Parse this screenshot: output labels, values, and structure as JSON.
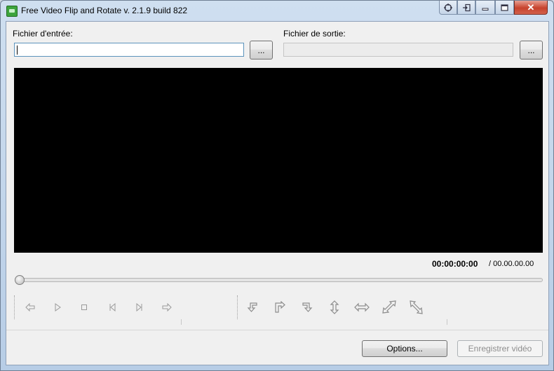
{
  "window": {
    "title": "Free Video Flip and Rotate  v. 2.1.9 build 822",
    "buttons": [
      "restore-icon",
      "pin-icon",
      "minimize-icon",
      "maximize-icon",
      "close-icon"
    ],
    "close_label": "✕"
  },
  "input": {
    "label": "Fichier d'entrée:",
    "value": "",
    "browse_label": "..."
  },
  "output": {
    "label": "Fichier de sortie:",
    "value": "",
    "browse_label": "..."
  },
  "time": {
    "current": "00:00:00:00",
    "total": "/  00.00.00.00"
  },
  "playback": {
    "position_fraction": 0,
    "controls": [
      "prev-frame-icon",
      "play-icon",
      "stop-icon",
      "go-start-icon",
      "go-end-icon",
      "next-frame-icon"
    ]
  },
  "transform": {
    "controls": [
      "rotate-left-icon",
      "rotate-right-icon",
      "rotate-180-icon",
      "flip-vertical-icon",
      "flip-horizontal-icon",
      "transpose-icon",
      "transverse-icon"
    ]
  },
  "actions": {
    "options_label": "Options...",
    "save_label": "Enregistrer vidéo"
  }
}
